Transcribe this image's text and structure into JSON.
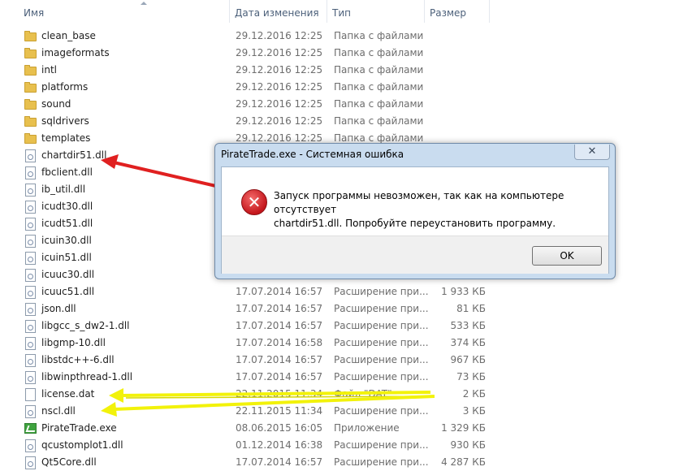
{
  "columns": {
    "name": "Имя",
    "date": "Дата изменения",
    "type": "Тип",
    "size": "Размер"
  },
  "files": [
    {
      "name": "clean_base",
      "date": "29.12.2016 12:25",
      "type": "Папка с файлами",
      "size": "",
      "icon": "folder-icon"
    },
    {
      "name": "imageformats",
      "date": "29.12.2016 12:25",
      "type": "Папка с файлами",
      "size": "",
      "icon": "folder-icon"
    },
    {
      "name": "intl",
      "date": "29.12.2016 12:25",
      "type": "Папка с файлами",
      "size": "",
      "icon": "folder-icon"
    },
    {
      "name": "platforms",
      "date": "29.12.2016 12:25",
      "type": "Папка с файлами",
      "size": "",
      "icon": "folder-icon"
    },
    {
      "name": "sound",
      "date": "29.12.2016 12:25",
      "type": "Папка с файлами",
      "size": "",
      "icon": "folder-icon"
    },
    {
      "name": "sqldrivers",
      "date": "29.12.2016 12:25",
      "type": "Папка с файлами",
      "size": "",
      "icon": "folder-icon"
    },
    {
      "name": "templates",
      "date": "29.12.2016 12:25",
      "type": "Папка с файлами",
      "size": "",
      "icon": "folder-icon"
    },
    {
      "name": "chartdir51.dll",
      "date": "",
      "type": "",
      "size": "",
      "icon": "dll-file-icon"
    },
    {
      "name": "fbclient.dll",
      "date": "",
      "type": "",
      "size": "",
      "icon": "dll-file-icon"
    },
    {
      "name": "ib_util.dll",
      "date": "",
      "type": "",
      "size": "",
      "icon": "dll-file-icon"
    },
    {
      "name": "icudt30.dll",
      "date": "",
      "type": "",
      "size": "",
      "icon": "dll-file-icon"
    },
    {
      "name": "icudt51.dll",
      "date": "",
      "type": "",
      "size": "",
      "icon": "dll-file-icon"
    },
    {
      "name": "icuin30.dll",
      "date": "",
      "type": "",
      "size": "",
      "icon": "dll-file-icon"
    },
    {
      "name": "icuin51.dll",
      "date": "",
      "type": "",
      "size": "",
      "icon": "dll-file-icon"
    },
    {
      "name": "icuuc30.dll",
      "date": "",
      "type": "",
      "size": "",
      "icon": "dll-file-icon"
    },
    {
      "name": "icuuc51.dll",
      "date": "17.07.2014 16:57",
      "type": "Расширение при...",
      "size": "1 933 КБ",
      "icon": "dll-file-icon"
    },
    {
      "name": "json.dll",
      "date": "17.07.2014 16:57",
      "type": "Расширение при...",
      "size": "81 КБ",
      "icon": "dll-file-icon"
    },
    {
      "name": "libgcc_s_dw2-1.dll",
      "date": "17.07.2014 16:57",
      "type": "Расширение при...",
      "size": "533 КБ",
      "icon": "dll-file-icon"
    },
    {
      "name": "libgmp-10.dll",
      "date": "17.07.2014 16:58",
      "type": "Расширение при...",
      "size": "374 КБ",
      "icon": "dll-file-icon"
    },
    {
      "name": "libstdc++-6.dll",
      "date": "17.07.2014 16:57",
      "type": "Расширение при...",
      "size": "967 КБ",
      "icon": "dll-file-icon"
    },
    {
      "name": "libwinpthread-1.dll",
      "date": "17.07.2014 16:57",
      "type": "Расширение при...",
      "size": "73 КБ",
      "icon": "dll-file-icon"
    },
    {
      "name": "license.dat",
      "date": "22.11.2015 11:34",
      "type": "Файл \"DAT\"",
      "size": "2 КБ",
      "icon": "dat-file-icon"
    },
    {
      "name": "nscl.dll",
      "date": "22.11.2015 11:34",
      "type": "Расширение при...",
      "size": "3 КБ",
      "icon": "dll-file-icon"
    },
    {
      "name": "PirateTrade.exe",
      "date": "08.06.2015 16:05",
      "type": "Приложение",
      "size": "1 329 КБ",
      "icon": "exe-icon"
    },
    {
      "name": "qcustomplot1.dll",
      "date": "01.12.2014 16:38",
      "type": "Расширение при...",
      "size": "930 КБ",
      "icon": "dll-file-icon"
    },
    {
      "name": "Qt5Core.dll",
      "date": "17.07.2014 16:57",
      "type": "Расширение при...",
      "size": "4 287 КБ",
      "icon": "dll-file-icon"
    }
  ],
  "dialog": {
    "title": "PirateTrade.exe - Системная ошибка",
    "close_label": "✕",
    "icon": "error-icon",
    "message_line1": "Запуск программы невозможен, так как на компьютере отсутствует",
    "message_line2": "chartdir51.dll. Попробуйте переустановить программу.",
    "ok_label": "OK"
  },
  "annotations": {
    "red_arrow_color": "#e02020",
    "yellow_arrow_color": "#f2f20a"
  }
}
